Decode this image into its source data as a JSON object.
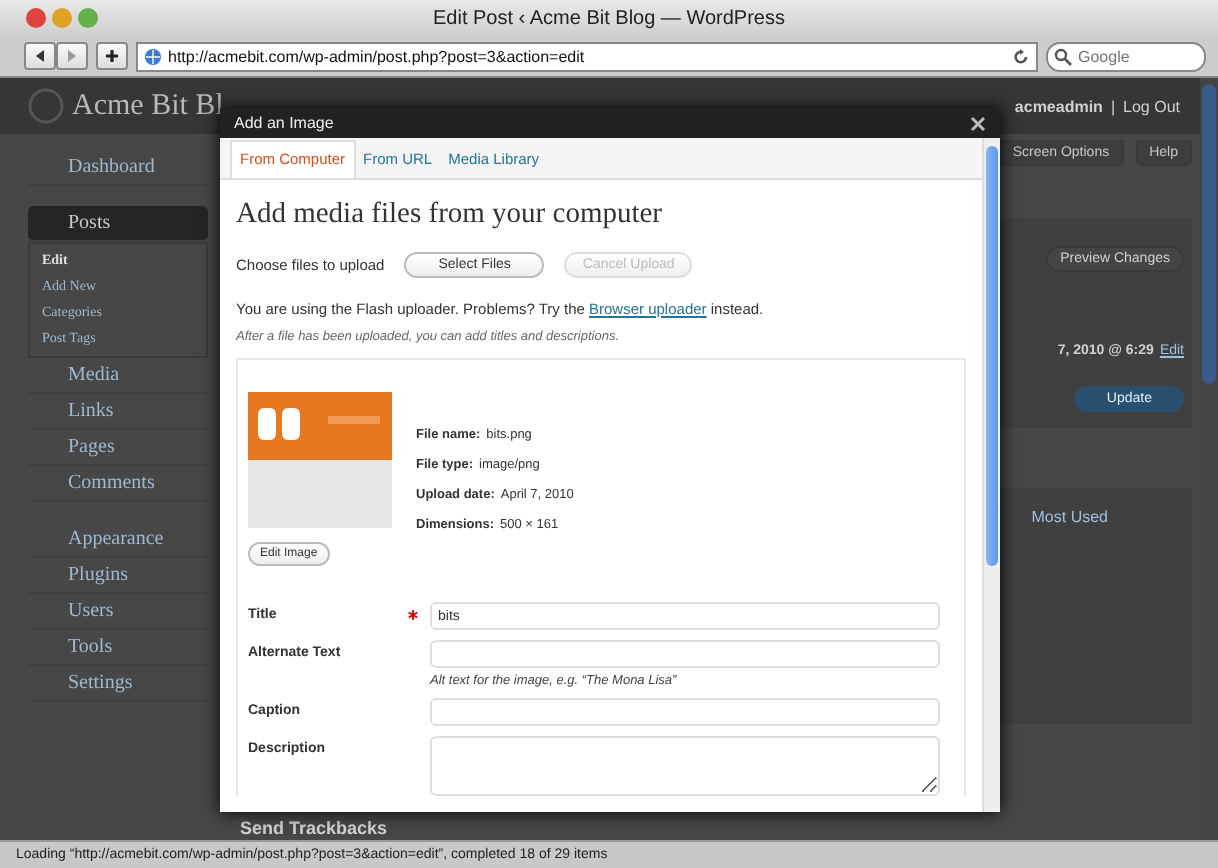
{
  "window": {
    "title": "Edit Post ‹ Acme Bit Blog — WordPress"
  },
  "toolbar": {
    "url": "http://acmebit.com/wp-admin/post.php?post=3&action=edit",
    "search": {
      "placeholder": "Google"
    }
  },
  "admin": {
    "site_title": "Acme Bit Bl",
    "user": "acmeadmin",
    "separator": "|",
    "logout": "Log Out",
    "menu": [
      [
        {
          "label": "Dashboard",
          "selected": false
        }
      ],
      [
        {
          "label": "Posts",
          "selected": true,
          "children": [
            {
              "label": "Edit",
              "selected": true
            },
            {
              "label": "Add New",
              "selected": false
            },
            {
              "label": "Categories",
              "selected": false
            },
            {
              "label": "Post Tags",
              "selected": false
            }
          ]
        },
        {
          "label": "Media",
          "selected": false
        },
        {
          "label": "Links",
          "selected": false
        },
        {
          "label": "Pages",
          "selected": false
        },
        {
          "label": "Comments",
          "selected": false
        }
      ],
      [
        {
          "label": "Appearance",
          "selected": false
        },
        {
          "label": "Plugins",
          "selected": false
        },
        {
          "label": "Users",
          "selected": false
        },
        {
          "label": "Tools",
          "selected": false
        },
        {
          "label": "Settings",
          "selected": false
        }
      ]
    ],
    "screen_options": "Screen Options",
    "help": "Help",
    "preview_button": "Preview Changes",
    "published": "7, 2010 @ 6:29",
    "edit_link": "Edit",
    "update_button": "Update",
    "categories_tab": "Most Used",
    "trackbacks": "Send Trackbacks"
  },
  "dialog": {
    "title": "Add an Image",
    "tabs": [
      {
        "label": "From Computer",
        "selected": true
      },
      {
        "label": "From URL",
        "selected": false
      },
      {
        "label": "Media Library",
        "selected": false
      }
    ],
    "heading": "Add media files from your computer",
    "choose_label": "Choose files to upload",
    "select_button": "Select Files",
    "cancel_button": {
      "label": "Cancel Upload",
      "disabled": true
    },
    "notice": {
      "before": "You are using the Flash uploader. Problems? Try the",
      "link": "Browser uploader",
      "after": "instead."
    },
    "hint": "After a file has been uploaded, you can add titles and descriptions.",
    "file": {
      "kind": "picture",
      "details": [
        {
          "label": "File name:",
          "value": "bits.png"
        },
        {
          "label": "File type:",
          "value": "image/png"
        },
        {
          "label": "Upload date:",
          "value": "April 7, 2010"
        },
        {
          "label": "Dimensions:",
          "value": "500 × 161"
        }
      ],
      "edit_button": "Edit Image"
    },
    "fields": [
      {
        "kind": "input",
        "label": "Title",
        "required": true,
        "value": "bits"
      },
      {
        "kind": "input",
        "label": "Alternate Text",
        "required": false,
        "help": "Alt text for the image, e.g. “The Mona Lisa”"
      },
      {
        "kind": "input",
        "label": "Caption",
        "required": false
      },
      {
        "kind": "textarea",
        "label": "Description",
        "required": false
      }
    ]
  },
  "status_bar": "Loading “http://acmebit.com/wp-admin/post.php?post=3&action=edit”, completed 18 of 29 items"
}
